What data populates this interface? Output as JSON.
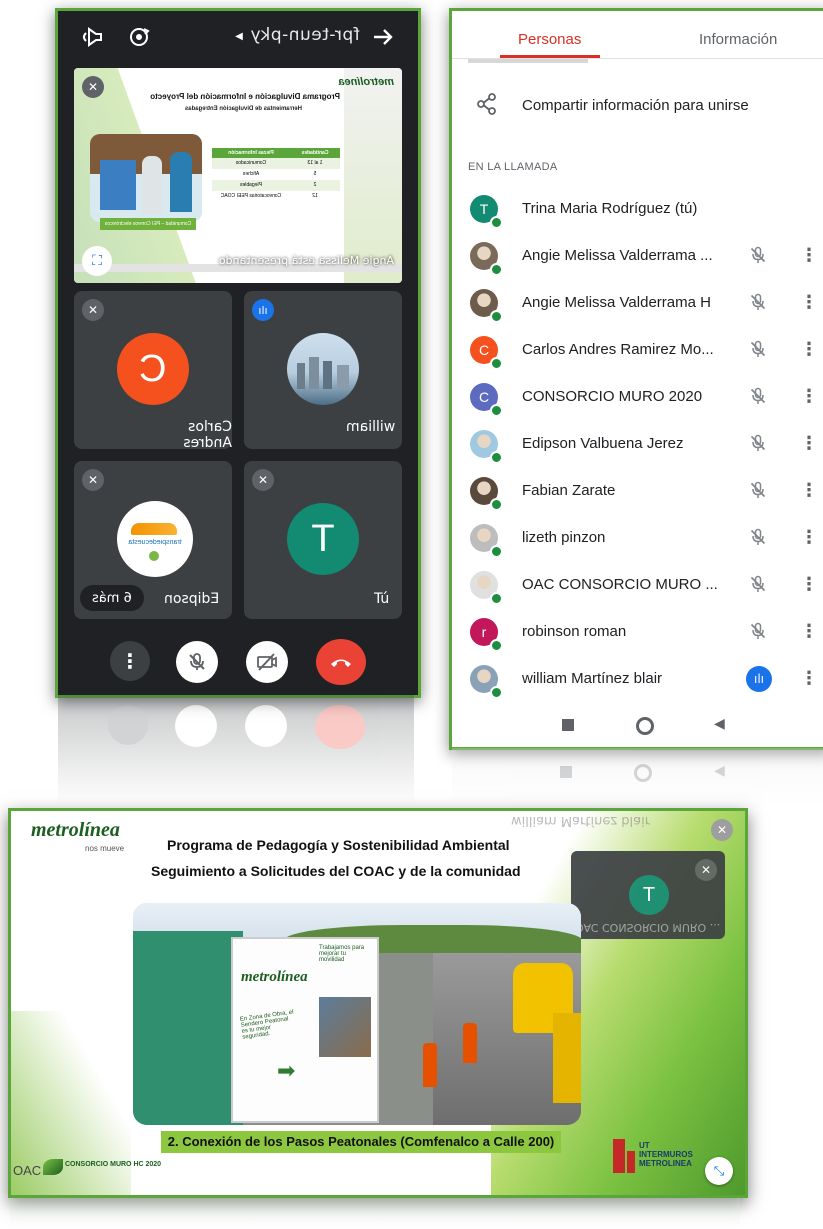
{
  "meet": {
    "meeting_code": "fpr-teun-pky",
    "presenter_banner": "Angie Melissa está presentando",
    "slide": {
      "brand": "metrolínea",
      "title": "Programa Divulgación e Información del Proyecto",
      "subtitle": "Herramientas de Divulgación Entregadas",
      "table_headers": [
        "Cantidades",
        "Piezas Información"
      ],
      "table_rows": [
        [
          "1 al 13",
          "Comunicados"
        ],
        [
          "5",
          "Afiches"
        ],
        [
          "2",
          "Plegables"
        ],
        [
          "12",
          "Convocatorias PEEI COAC"
        ]
      ],
      "caption": "Comunidad – PEI Correos electrónicos"
    },
    "tiles": [
      {
        "name": "Carlos Andres",
        "initial": "C",
        "color": "#f4511e"
      },
      {
        "name": "william",
        "initial": "",
        "color": ""
      },
      {
        "name": "Edipson",
        "initial": "",
        "color": ""
      },
      {
        "name": "Tú",
        "initial": "T",
        "color": "#138a72"
      }
    ],
    "more_chip": "6 más",
    "edipson_logo_text": "transpiedecuesta",
    "icons": {
      "back": "arrow-left-icon",
      "rotate": "switch-camera-icon",
      "audio": "speaker-icon"
    }
  },
  "people": {
    "tabs": [
      "Personas",
      "Información"
    ],
    "share_label": "Compartir información para unirse",
    "section_label": "EN LA LLAMADA",
    "participants": [
      {
        "name": "Trina Maria Rodríguez (tú)",
        "initial": "T",
        "color": "#138a72",
        "muted": false,
        "speaking": false,
        "photo": false
      },
      {
        "name": "Angie Melissa Valderrama ...",
        "initial": "",
        "color": "#7a6a5a",
        "muted": true,
        "speaking": false,
        "photo": true
      },
      {
        "name": "Angie Melissa Valderrama H",
        "initial": "",
        "color": "#6d5b4b",
        "muted": true,
        "speaking": false,
        "photo": true
      },
      {
        "name": "Carlos Andres Ramirez Mo...",
        "initial": "C",
        "color": "#f4511e",
        "muted": true,
        "speaking": false,
        "photo": false
      },
      {
        "name": "CONSORCIO MURO 2020",
        "initial": "C",
        "color": "#5c6bc0",
        "muted": true,
        "speaking": false,
        "photo": false
      },
      {
        "name": "Edipson Valbuena Jerez",
        "initial": "",
        "color": "#9ec9e0",
        "muted": true,
        "speaking": false,
        "photo": true
      },
      {
        "name": "Fabian Zarate",
        "initial": "",
        "color": "#5a4a3e",
        "muted": true,
        "speaking": false,
        "photo": true
      },
      {
        "name": "lizeth pinzon",
        "initial": "",
        "color": "#bdbdbd",
        "muted": true,
        "speaking": false,
        "photo": true
      },
      {
        "name": "OAC CONSORCIO MURO ...",
        "initial": "",
        "color": "#e0e0e0",
        "muted": true,
        "speaking": false,
        "photo": true
      },
      {
        "name": "robinson roman",
        "initial": "r",
        "color": "#c2185b",
        "muted": true,
        "speaking": false,
        "photo": false
      },
      {
        "name": "william Martínez blair",
        "initial": "",
        "color": "#8aa2b8",
        "muted": false,
        "speaking": true,
        "photo": true
      }
    ]
  },
  "slide": {
    "brand": "metrolínea",
    "brand_tagline": "nos mueve",
    "title_line1": "Programa de Pedagogía y Sostenibilidad Ambiental",
    "title_line2": "Seguimiento a Solicitudes del COAC y de la comunidad",
    "caption": "2. Conexión de los Pasos Peatonales (Comfenalco a Calle 200)",
    "sign_brand": "metrolínea",
    "sign_text1": "Trabajamos para mejorar tu movilidad",
    "sign_text2": "En Zona de Obra, el Sendero Peatonal es tu mejor seguridad.",
    "footer_left": "OAC",
    "footer_consorcio": "CONSORCIO MURO HC 2020",
    "footer_right": "UT INTERMUROS METROLINEA",
    "self_tile_initial": "T",
    "reflection_text1": "william Martínez blair",
    "reflection_text2": "robinson roman",
    "reflection_text3": "OAC CONSORCIO MURO ..."
  },
  "colors": {
    "accent_green": "#5aa63b",
    "meet_red": "#ea4335",
    "tab_active": "#d93025",
    "speaking_blue": "#1a73e8"
  }
}
